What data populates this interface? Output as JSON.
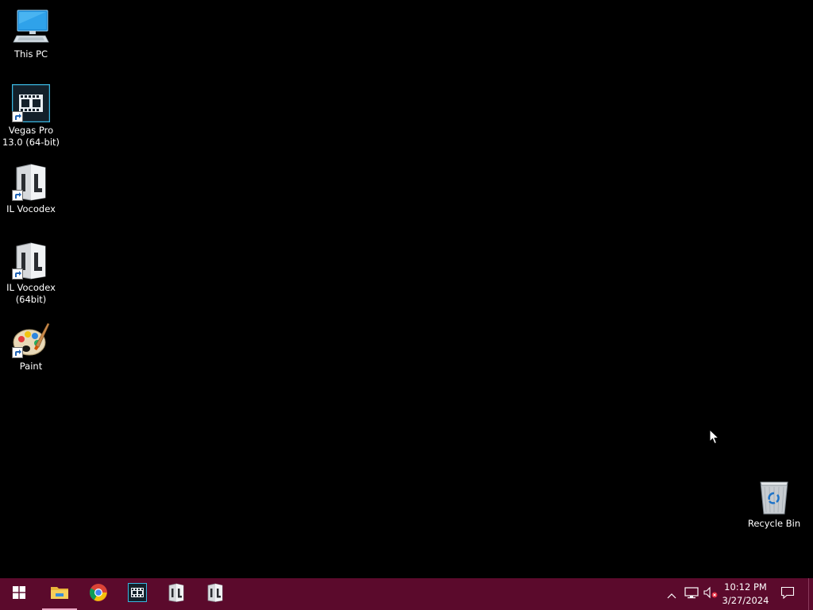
{
  "desktop": {
    "icons": [
      {
        "label": "This PC",
        "icon": "this-pc-icon"
      },
      {
        "label": "Vegas Pro 13.0 (64-bit)",
        "icon": "vegas-pro-icon"
      },
      {
        "label": "IL Vocodex",
        "icon": "il-vocodex-icon"
      },
      {
        "label": "IL Vocodex (64bit)",
        "icon": "il-vocodex-64-icon"
      },
      {
        "label": "Paint",
        "icon": "paint-icon"
      },
      {
        "label": "Recycle Bin",
        "icon": "recycle-bin-icon"
      }
    ]
  },
  "taskbar": {
    "color": "#5b0a2c",
    "pinned": [
      {
        "name": "start",
        "icon": "windows-start-icon"
      },
      {
        "name": "file-explorer",
        "icon": "file-explorer-icon"
      },
      {
        "name": "chrome",
        "icon": "chrome-icon"
      },
      {
        "name": "vegas-pro",
        "icon": "vegas-pro-icon"
      },
      {
        "name": "il-vocodex",
        "icon": "il-vocodex-icon"
      },
      {
        "name": "il-vocodex-64",
        "icon": "il-vocodex-icon"
      }
    ],
    "tray": {
      "icons": [
        "chevron-up-icon",
        "network-icon",
        "volume-muted-icon",
        "notifications-icon"
      ],
      "time": "10:12 PM",
      "date": "3/27/2024"
    }
  }
}
